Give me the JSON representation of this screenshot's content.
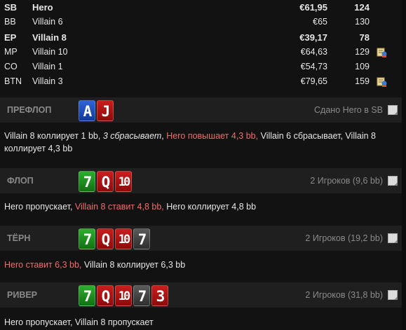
{
  "players": [
    {
      "pos": "SB",
      "name": "Hero",
      "stack": "€61,95",
      "bb": "124",
      "bold": true,
      "notes": false
    },
    {
      "pos": "BB",
      "name": "Villain 6",
      "stack": "€65",
      "bb": "130",
      "bold": false,
      "notes": false
    },
    {
      "pos": "EP",
      "name": "Villain 8",
      "stack": "€39,17",
      "bb": "78",
      "bold": true,
      "notes": false
    },
    {
      "pos": "MP",
      "name": "Villain 10",
      "stack": "€64,63",
      "bb": "129",
      "bold": false,
      "notes": true
    },
    {
      "pos": "CO",
      "name": "Villain 1",
      "stack": "€54,73",
      "bb": "109",
      "bold": false,
      "notes": false
    },
    {
      "pos": "BTN",
      "name": "Villain 3",
      "stack": "€79,65",
      "bb": "159",
      "bold": false,
      "notes": true
    }
  ],
  "streets": [
    {
      "key": "preflop",
      "label": "ПРЕФЛОП",
      "info": "Сдано Hero в SB",
      "cards": [
        {
          "rank": "A",
          "suit": "d"
        },
        {
          "rank": "J",
          "suit": "h"
        }
      ],
      "actions": [
        {
          "text": "Villain 8 коллирует 1 bb, ",
          "style": ""
        },
        {
          "text": "3 сбрасывает",
          "style": "ital"
        },
        {
          "text": ", ",
          "style": ""
        },
        {
          "text": "Hero повышает 4,3 bb,",
          "style": "red"
        },
        {
          "text": " Villain 6 сбрасывает, Villain 8 коллирует 4,3 bb",
          "style": ""
        }
      ]
    },
    {
      "key": "flop",
      "label": "ФЛОП",
      "info": "2 Игроков (9,6 bb)",
      "cards": [
        {
          "rank": "7",
          "suit": "c"
        },
        {
          "rank": "Q",
          "suit": "h"
        },
        {
          "rank": "10",
          "suit": "h"
        }
      ],
      "actions": [
        {
          "text": "Hero пропускает, ",
          "style": ""
        },
        {
          "text": "Villain 8 ставит 4,8 bb,",
          "style": "red"
        },
        {
          "text": " Hero коллирует 4,8 bb",
          "style": ""
        }
      ]
    },
    {
      "key": "turn",
      "label": "ТЁРН",
      "info": "2 Игроков (19,2 bb)",
      "cards": [
        {
          "rank": "7",
          "suit": "c"
        },
        {
          "rank": "Q",
          "suit": "h"
        },
        {
          "rank": "10",
          "suit": "h"
        },
        {
          "rank": "7",
          "suit": "s"
        }
      ],
      "actions": [
        {
          "text": "Hero ставит 6,3 bb,",
          "style": "red"
        },
        {
          "text": " Villain 8 коллирует 6,3 bb",
          "style": ""
        }
      ]
    },
    {
      "key": "river",
      "label": "РИВЕР",
      "info": "2 Игроков (31,8 bb)",
      "cards": [
        {
          "rank": "7",
          "suit": "c"
        },
        {
          "rank": "Q",
          "suit": "h"
        },
        {
          "rank": "10",
          "suit": "h"
        },
        {
          "rank": "7",
          "suit": "s"
        },
        {
          "rank": "3",
          "suit": "h"
        }
      ],
      "actions": [
        {
          "text": "Hero пропускает, Villain 8 пропускает",
          "style": ""
        }
      ]
    }
  ],
  "colors": {
    "background": "#121212",
    "header_bar": "#1f1f1f",
    "highlight_action": "#f26b6b",
    "spades": "#3a3a3a",
    "hearts": "#b01515",
    "diamonds": "#1f4fbf",
    "clubs": "#1f8f1f"
  }
}
